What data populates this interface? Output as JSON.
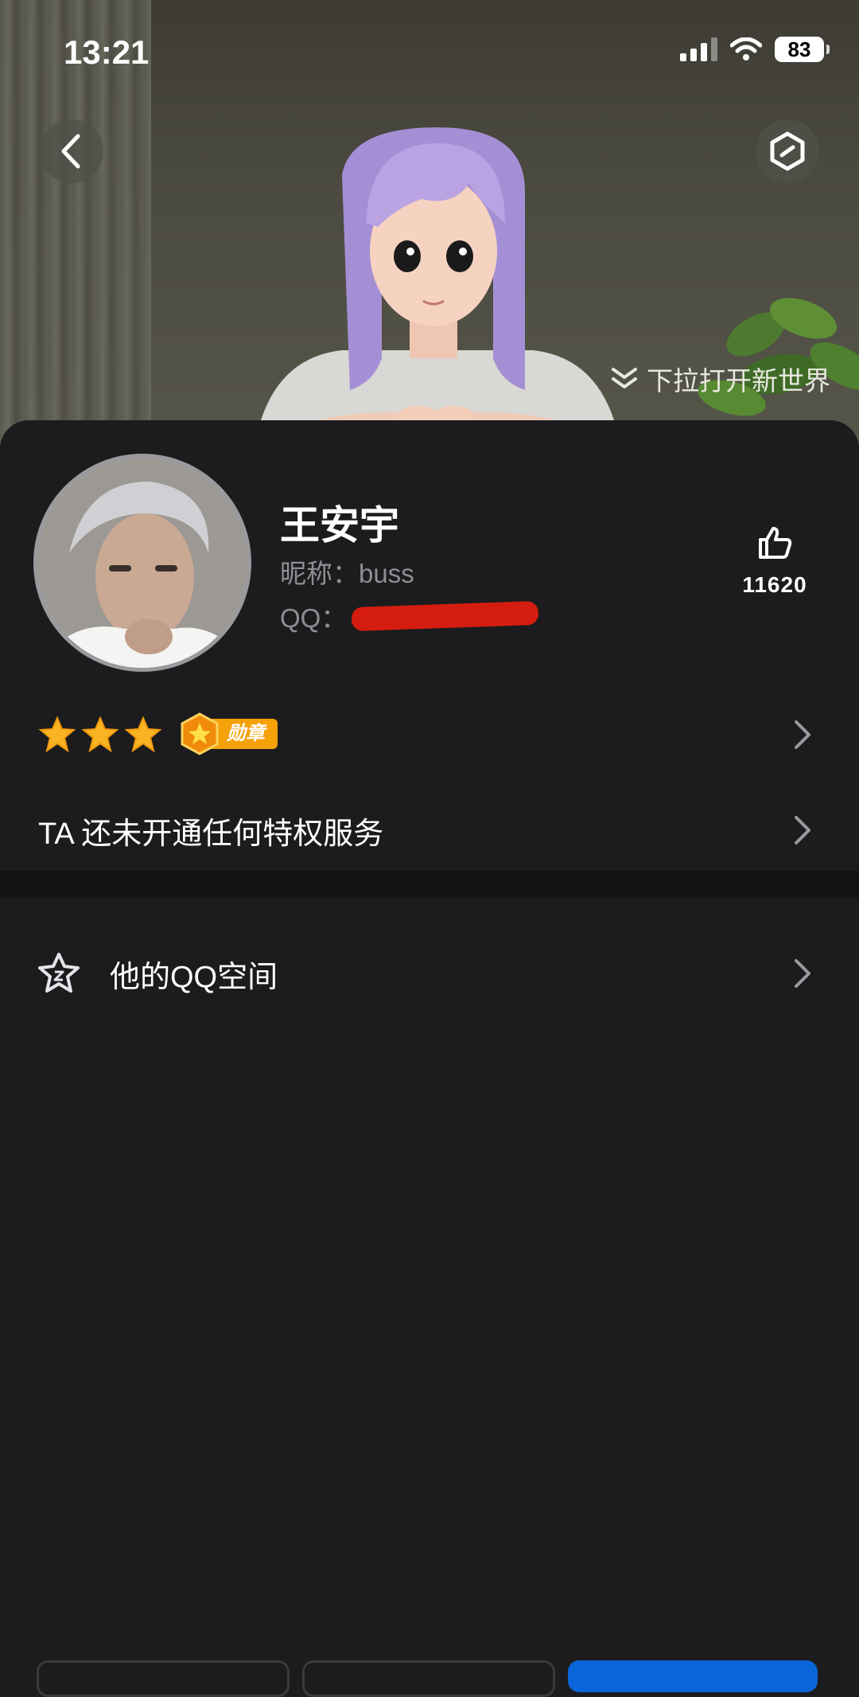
{
  "status_bar": {
    "time": "13:21",
    "battery": "83"
  },
  "header": {
    "pull_hint": "下拉打开新世界"
  },
  "profile": {
    "name": "王安宇",
    "nickname": "昵称：buss",
    "qq_label": "QQ：",
    "likes": "11620"
  },
  "badges": {
    "star_count": 3,
    "medal_label": "勋章"
  },
  "rows": {
    "privilege": "TA 还未开通任何特权服务",
    "qzone": "他的QQ空间"
  },
  "colors": {
    "accent_blue": "#0a66d8",
    "medal_orange": "#f5a10a",
    "background": "#1c1c1e"
  },
  "icons": {
    "back": "chevron-left-icon",
    "settings": "hexagon-icon",
    "pull": "double-chevron-down-icon",
    "like": "thumbs-up-icon",
    "star": "star-icon",
    "medal": "hexagon-star-icon",
    "qzone": "star-outline-icon",
    "chevron": "chevron-right-icon"
  }
}
